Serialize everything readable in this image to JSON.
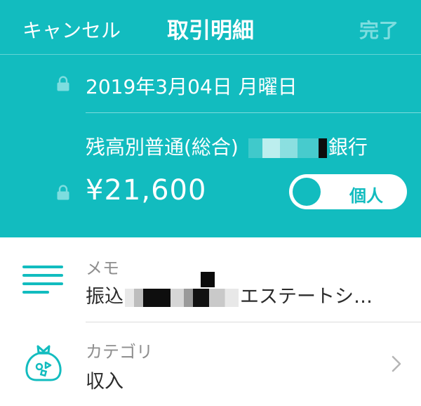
{
  "nav": {
    "cancel_label": "キャンセル",
    "title": "取引明細",
    "done_label": "完了"
  },
  "transaction": {
    "date": "2019年3月04日 月曜日",
    "account_prefix": "残高別普通(総合)",
    "account_suffix": "銀行",
    "amount": "¥21,600",
    "toggle_label": "個人"
  },
  "memo": {
    "label": "メモ",
    "value_prefix": "振込",
    "value_suffix": "エステートシ…"
  },
  "category": {
    "label": "カテゴリ",
    "value": "収入"
  },
  "colors": {
    "accent": "#12bcbf",
    "done_disabled": "#7ddddf",
    "label_gray": "#8e8e8e"
  },
  "icons": {
    "lock": "lock-icon",
    "memo": "lines-icon",
    "category": "money-bag-icon",
    "chevron": "chevron-right-icon"
  }
}
